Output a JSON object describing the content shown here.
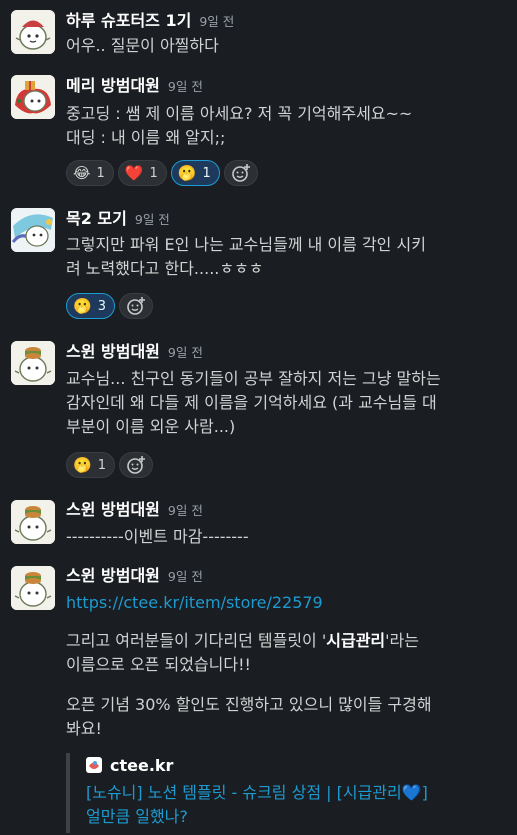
{
  "messages": [
    {
      "author": "하루 슈포터즈 1기",
      "time": "9일 전",
      "lines": [
        "어우.. 질문이 아찔하다"
      ]
    },
    {
      "author": "메리 방범대원",
      "time": "9일 전",
      "lines": [
        "중고딩 : 쌤 제 이름 아세요? 저 꼭 기억해주세요~~",
        "대딩 : 내 이름 왜 알지;;"
      ],
      "reactions": [
        {
          "emoji": "😂",
          "count": "1",
          "active": false
        },
        {
          "emoji": "❤️",
          "count": "1",
          "active": false
        },
        {
          "emoji": "🫢",
          "count": "1",
          "active": true
        }
      ]
    },
    {
      "author": "목2 모기",
      "time": "9일 전",
      "lines": [
        "그렇지만 파워 E인 나는 교수님들께 내 이름 각인 시키",
        "려 노력했다고 한다.....ㅎㅎㅎ"
      ],
      "reactions": [
        {
          "emoji": "🫢",
          "count": "3",
          "active": true
        }
      ]
    },
    {
      "author": "스윈 방범대원",
      "time": "9일 전",
      "lines": [
        "교수님... 친구인 동기들이 공부 잘하지 저는 그냥 말하는",
        "감자인데 왜 다들 제 이름을 기억하세요 (과 교수님들 대",
        "부분이 이름 외운 사람...)"
      ],
      "reactions": [
        {
          "emoji": "🫢",
          "count": "1",
          "active": false
        }
      ]
    },
    {
      "author": "스윈 방범대원",
      "time": "9일 전",
      "lines": [
        "----------이벤트 마감--------"
      ]
    },
    {
      "author": "스윈 방범대원",
      "time": "9일 전",
      "link": "https://ctee.kr/item/store/22579",
      "para1_a": "그리고 여러분들이 기다리던 템플릿이 '",
      "para1_bold": "시급관리",
      "para1_b": "'라는",
      "para1_line2": "이름으로 오픈 되었습니다!!",
      "para2_line1": "오픈 기념 30% 할인도 진행하고 있으니 많이들 구경해",
      "para2_line2": "봐요!",
      "preview": {
        "site": "ctee.kr",
        "title_line1": "[노슈니] 노션 템플릿 - 슈크림 상점 | [시급관리💙]",
        "title_line2": "얼만큼 일했나?"
      }
    }
  ],
  "colors": {
    "link": "#1d9bd1",
    "background": "#1a1d21",
    "reaction_active": "#1d9bd1"
  }
}
